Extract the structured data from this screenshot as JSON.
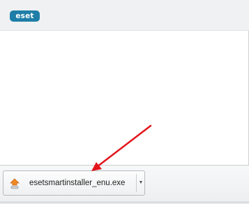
{
  "brand": {
    "logo_text": "eset",
    "logo_color": "#1e7ea8"
  },
  "download_bar": {
    "file_name": "esetsmartinstaller_enu.exe",
    "file_icon": "installer-icon",
    "menu_icon": "chevron-down-icon"
  },
  "annotation": {
    "arrow_color": "#e3151d"
  }
}
